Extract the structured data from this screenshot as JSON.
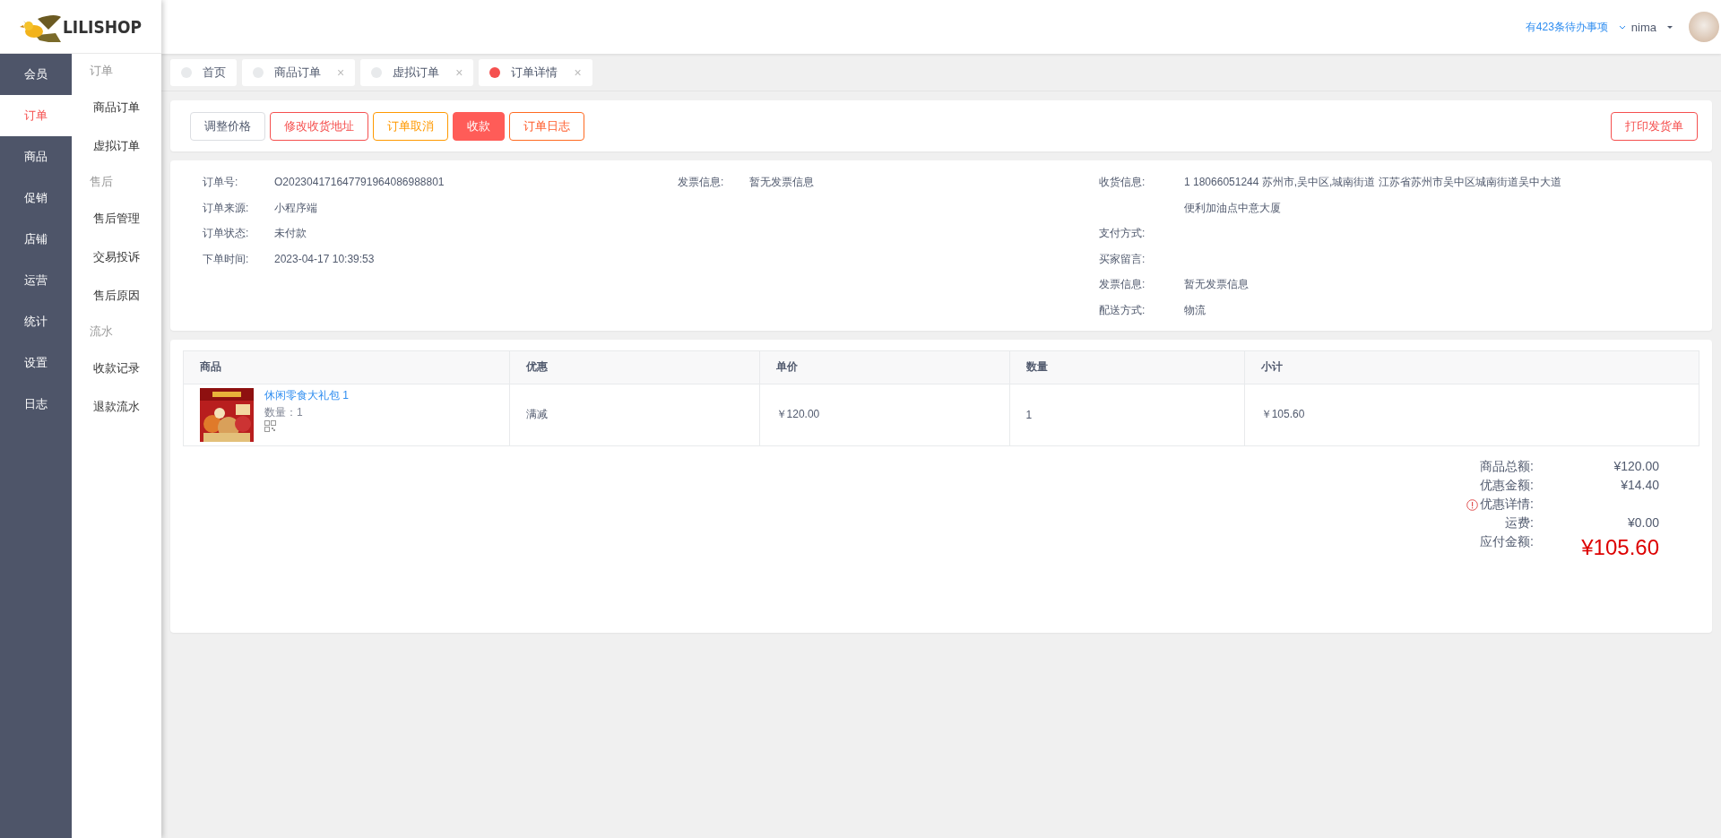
{
  "logo": {
    "text": "LILISHOP"
  },
  "nav": [
    {
      "label": "会员",
      "selected": false
    },
    {
      "label": "订单",
      "selected": true
    },
    {
      "label": "商品",
      "selected": false
    },
    {
      "label": "促销",
      "selected": false
    },
    {
      "label": "店铺",
      "selected": false
    },
    {
      "label": "运营",
      "selected": false
    },
    {
      "label": "统计",
      "selected": false
    },
    {
      "label": "设置",
      "selected": false
    },
    {
      "label": "日志",
      "selected": false
    }
  ],
  "subnav": [
    {
      "title": "订单",
      "items": [
        "商品订单",
        "虚拟订单"
      ]
    },
    {
      "title": "售后",
      "items": [
        "售后管理",
        "交易投诉",
        "售后原因"
      ]
    },
    {
      "title": "流水",
      "items": [
        "收款记录",
        "退款流水"
      ]
    }
  ],
  "header": {
    "todo": "有423条待办事项",
    "user": "nima"
  },
  "tabs": [
    {
      "label": "首页",
      "selected": false
    },
    {
      "label": "商品订单",
      "selected": false,
      "close": "×"
    },
    {
      "label": "虚拟订单",
      "selected": false,
      "close": "×"
    },
    {
      "label": "订单详情",
      "selected": true,
      "close": "×"
    }
  ],
  "actions": [
    {
      "label": "调整价格",
      "kind": "plain"
    },
    {
      "label": "修改收货地址",
      "kind": "danger"
    },
    {
      "label": "订单取消",
      "kind": "warning"
    },
    {
      "label": "收款",
      "kind": "filled"
    },
    {
      "label": "订单日志",
      "kind": "alert"
    }
  ],
  "print_button": {
    "label": "打印发货单",
    "kind": "danger"
  },
  "info": [
    [
      {
        "label": "订单号:",
        "value": "O202304171647791964086988801"
      },
      {
        "label": "订单来源:",
        "value": "小程序端"
      },
      {
        "label": "订单状态:",
        "value": "未付款"
      },
      {
        "label": "下单时间:",
        "value": "2023-04-17 10:39:53"
      }
    ],
    [
      {
        "label": "发票信息:",
        "value": "暂无发票信息"
      }
    ],
    [
      {
        "label": "收货信息:",
        "value": "1 18066051244 苏州市,吴中区,城南街道 江苏省苏州市吴中区城南街道吴中大道便利加油点中意大厦"
      },
      {
        "label": "支付方式:"
      },
      {
        "label": "买家留言:"
      },
      {
        "label": "发票信息:",
        "value": "暂无发票信息"
      },
      {
        "label": "配送方式:",
        "value": "物流"
      }
    ]
  ],
  "table": {
    "columns": [
      "商品",
      "优惠",
      "单价",
      "数量",
      "小计"
    ],
    "rows": [
      {
        "product": {
          "name": "休闲零食大礼包 1",
          "quantity": "数量：1"
        },
        "discount": "满减",
        "price": "￥120.00",
        "count": "1",
        "subtotal": "￥105.60"
      }
    ]
  },
  "totals": [
    {
      "label": "商品总额:",
      "value": "¥120.00",
      "kind": "normal"
    },
    {
      "label": "优惠金额:",
      "value": "¥14.40",
      "kind": "normal"
    },
    {
      "label": "优惠详情:",
      "kind": "info"
    },
    {
      "label": "运费:",
      "value": "¥0.00",
      "kind": "normal"
    },
    {
      "label": "应付金额:",
      "value": "¥105.60",
      "kind": "total"
    }
  ]
}
